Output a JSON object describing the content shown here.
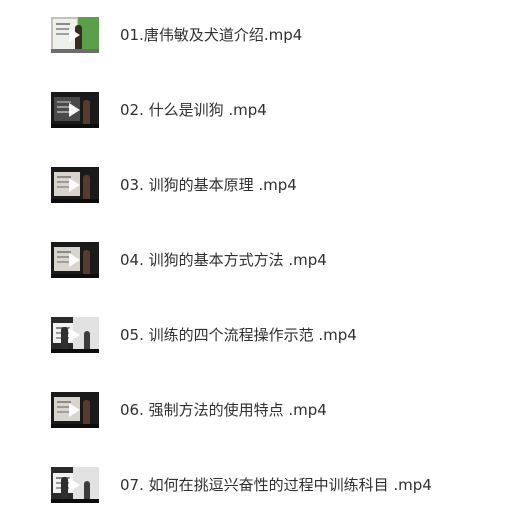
{
  "files": [
    {
      "name": "01.唐伟敏及犬道介绍.mp4",
      "thumbnail_icon": "video-thumbnail"
    },
    {
      "name": "02. 什么是训狗 .mp4",
      "thumbnail_icon": "video-thumbnail"
    },
    {
      "name": "03. 训狗的基本原理 .mp4",
      "thumbnail_icon": "video-thumbnail"
    },
    {
      "name": "04. 训狗的基本方式方法 .mp4",
      "thumbnail_icon": "video-thumbnail"
    },
    {
      "name": "05. 训练的四个流程操作示范 .mp4",
      "thumbnail_icon": "video-thumbnail"
    },
    {
      "name": "06. 强制方法的使用特点 .mp4",
      "thumbnail_icon": "video-thumbnail"
    },
    {
      "name": "07. 如何在挑逗兴奋性的过程中训练科目 .mp4",
      "thumbnail_icon": "video-thumbnail"
    }
  ]
}
